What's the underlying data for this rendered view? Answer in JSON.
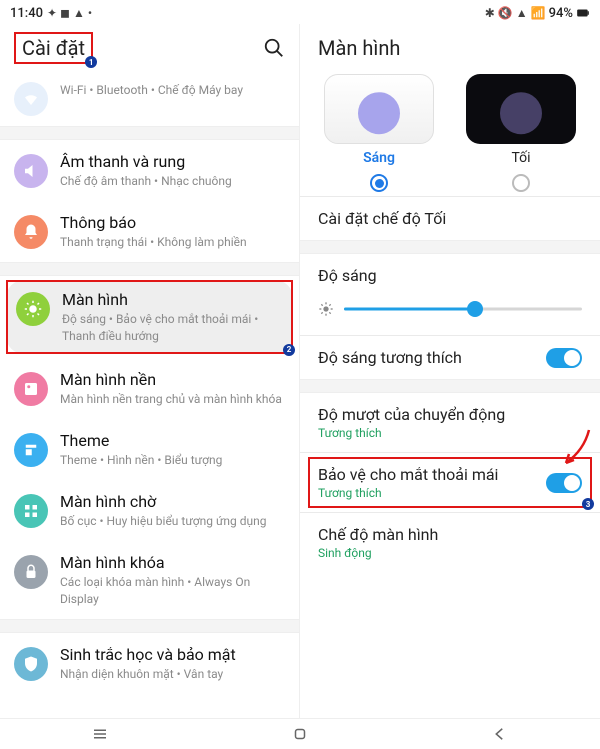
{
  "status": {
    "time": "11:40",
    "battery_text": "94%"
  },
  "left": {
    "title": "Cài đặt",
    "items": {
      "connections": {
        "title": "",
        "sub": "Wi-Fi  •  Bluetooth  •  Chế độ Máy bay"
      },
      "sound": {
        "title": "Âm thanh và rung",
        "sub": "Chế độ âm thanh  •  Nhạc chuông"
      },
      "notif": {
        "title": "Thông báo",
        "sub": "Thanh trạng thái  •  Không làm phiền"
      },
      "display": {
        "title": "Màn hình",
        "sub": "Độ sáng  •  Bảo vệ cho mắt thoải mái  •  Thanh điều hướng"
      },
      "wallpaper": {
        "title": "Màn hình nền",
        "sub": "Màn hình nền trang chủ và màn hình khóa"
      },
      "theme": {
        "title": "Theme",
        "sub": "Theme  •  Hình nền  •  Biểu tượng"
      },
      "home": {
        "title": "Màn hình chờ",
        "sub": "Bố cục  •  Huy hiệu biểu tượng ứng dụng"
      },
      "lock": {
        "title": "Màn hình khóa",
        "sub": "Các loại khóa màn hình  •  Always On Display"
      },
      "biometrics": {
        "title": "Sinh trắc học và bảo mật",
        "sub": "Nhận diện khuôn mặt  •  Vân tay"
      }
    }
  },
  "right": {
    "title": "Màn hình",
    "theme_light": "Sáng",
    "theme_dark": "Tối",
    "dark_mode_settings": "Cài đặt chế độ Tối",
    "brightness": "Độ sáng",
    "adaptive_brightness": "Độ sáng tương thích",
    "motion_smooth": {
      "title": "Độ mượt của chuyển động",
      "sub": "Tương thích"
    },
    "eye_comfort": {
      "title": "Bảo vệ cho mắt thoải mái",
      "sub": "Tương thích"
    },
    "screen_mode": {
      "title": "Chế độ màn hình",
      "sub": "Sinh động"
    }
  },
  "badges": {
    "b1": "1",
    "b2": "2",
    "b3": "3"
  }
}
